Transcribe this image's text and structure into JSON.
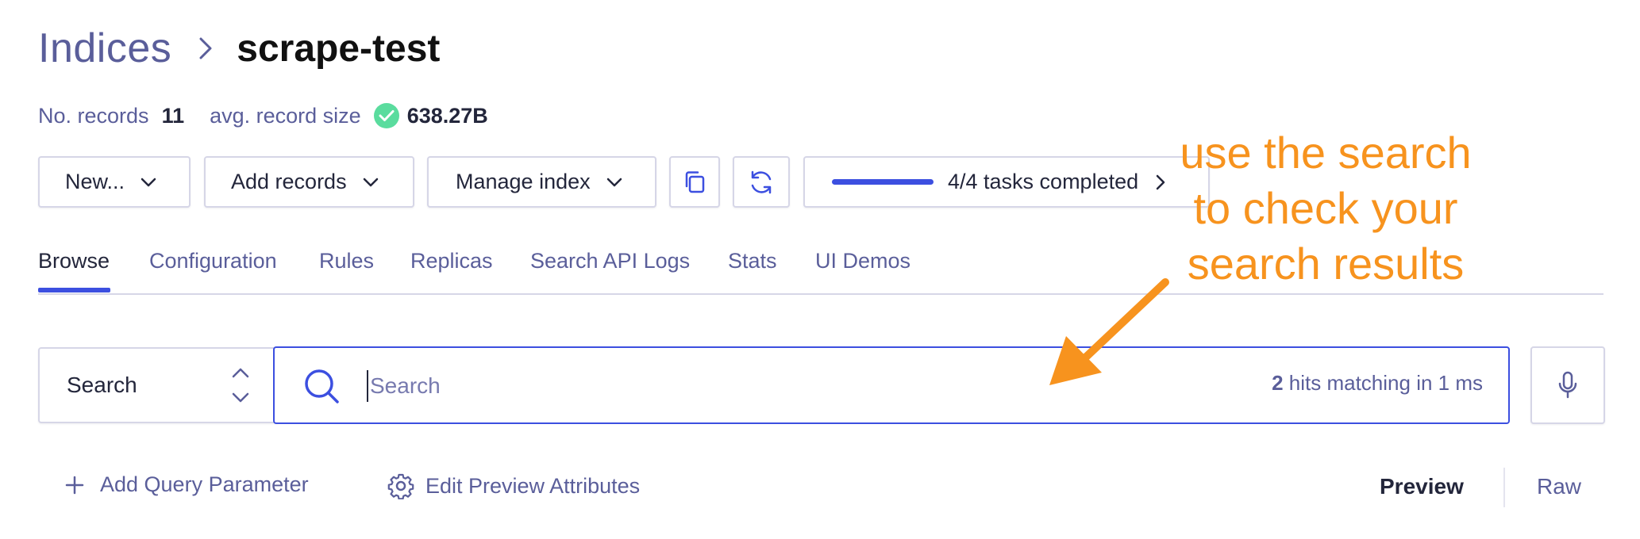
{
  "breadcrumb": {
    "root": "Indices",
    "current": "scrape-test"
  },
  "meta": {
    "records_label": "No. records",
    "records_value": "11",
    "size_label": "avg. record size",
    "size_value": "638.27B"
  },
  "toolbar": {
    "new_label": "New...",
    "add_records_label": "Add records",
    "manage_index_label": "Manage index",
    "tasks_label": "4/4 tasks completed",
    "tasks_progress": 1.0
  },
  "tabs": [
    {
      "label": "Browse",
      "active": true
    },
    {
      "label": "Configuration",
      "active": false
    },
    {
      "label": "Rules",
      "active": false
    },
    {
      "label": "Replicas",
      "active": false
    },
    {
      "label": "Search API Logs",
      "active": false
    },
    {
      "label": "Stats",
      "active": false
    },
    {
      "label": "UI Demos",
      "active": false
    }
  ],
  "search": {
    "mode_selected": "Search",
    "placeholder": "Search",
    "value": "",
    "hits_count": "2",
    "hits_suffix": " hits matching in 1 ms"
  },
  "actions": {
    "add_query_parameter": "Add Query Parameter",
    "edit_preview_attributes": "Edit Preview Attributes",
    "preview_label": "Preview",
    "raw_label": "Raw"
  },
  "annotation": {
    "line1": "use the search",
    "line2": "to check your",
    "line3": "search results",
    "color": "#f7931e"
  },
  "colors": {
    "accent": "#3c4fe0",
    "muted_text": "#5a5e9a",
    "success": "#5adc9e",
    "border": "#d6d6e7"
  },
  "icons": {
    "breadcrumb_separator": "chevron-right-icon",
    "size_status": "check-circle-icon",
    "copy": "copy-icon",
    "refresh": "refresh-icon",
    "search": "search-icon",
    "mic": "microphone-icon",
    "add": "plus-icon",
    "settings": "gear-icon"
  }
}
